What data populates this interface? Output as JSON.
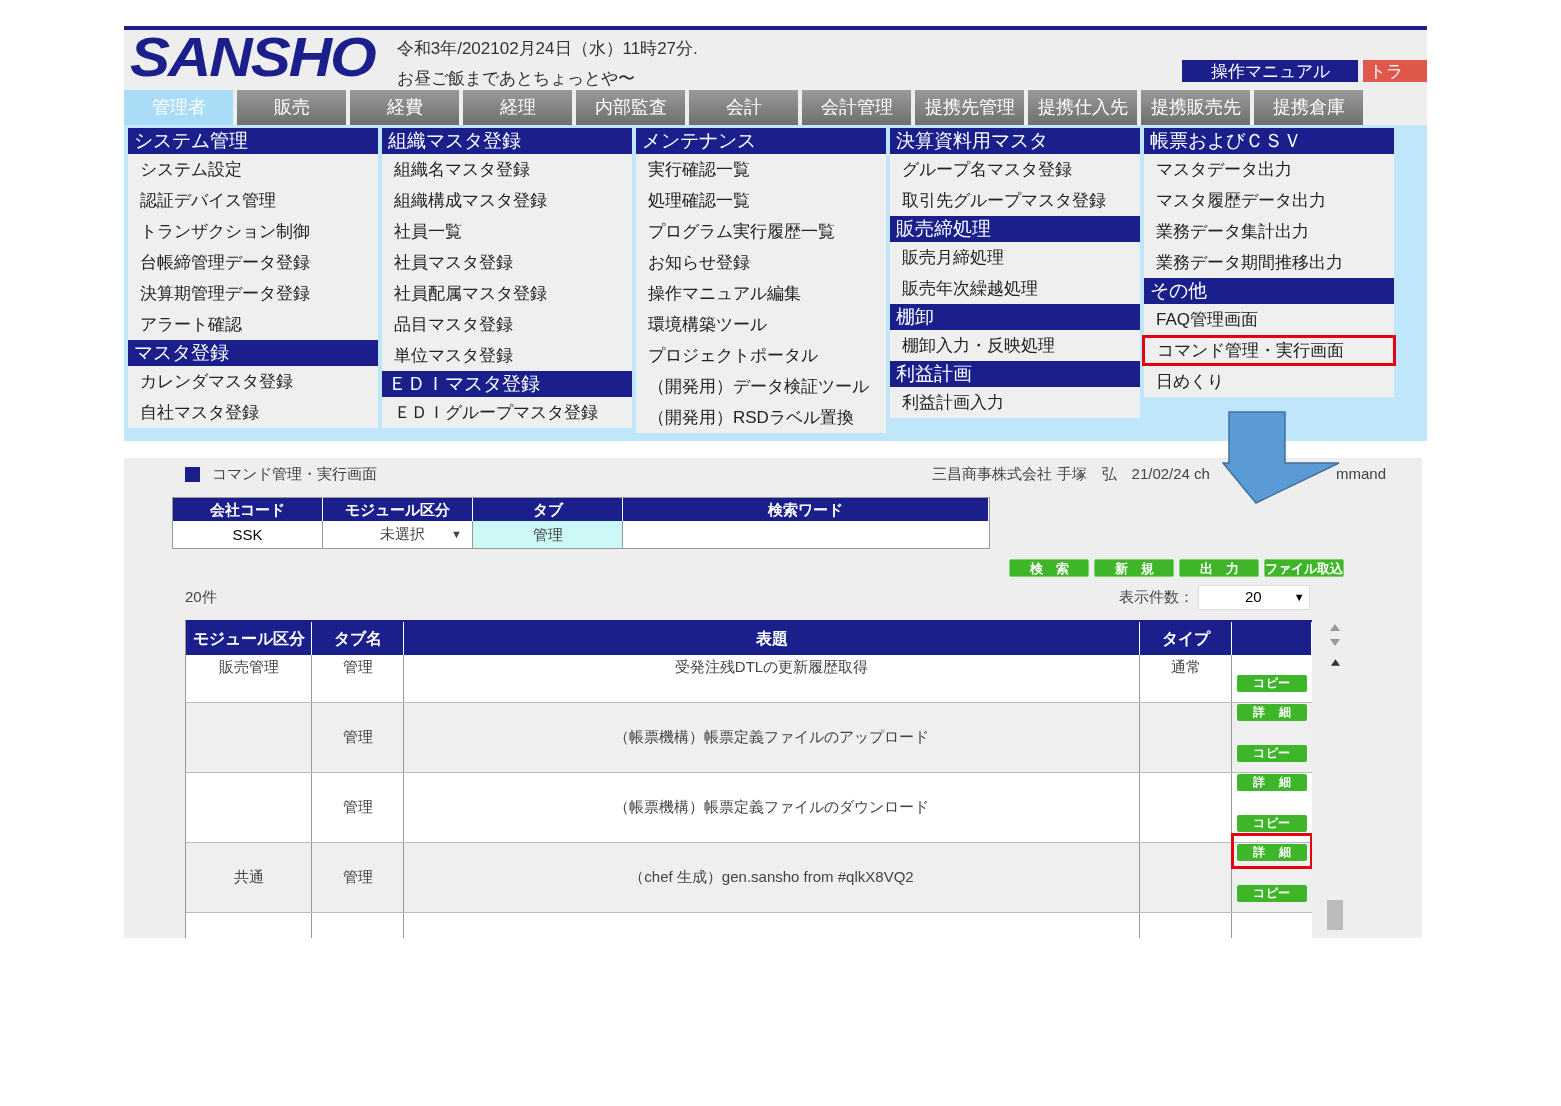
{
  "header": {
    "logo": "SANSHO",
    "datetime": "令和3年/202102月24日（水）11時27分.",
    "message": "お昼ご飯まであとちょっとや〜",
    "buttons": [
      {
        "label": "操作マニュアル",
        "color": "#1a1f8c"
      },
      {
        "label": "トラ",
        "color": "#e0574c"
      }
    ]
  },
  "nav_tabs": [
    {
      "label": "管理者",
      "selected": true
    },
    {
      "label": "販売",
      "selected": false
    },
    {
      "label": "経費",
      "selected": false
    },
    {
      "label": "経理",
      "selected": false
    },
    {
      "label": "内部監査",
      "selected": false
    },
    {
      "label": "会計",
      "selected": false
    },
    {
      "label": "会計管理",
      "selected": false
    },
    {
      "label": "提携先管理",
      "selected": false
    },
    {
      "label": "提携仕入先",
      "selected": false
    },
    {
      "label": "提携販売先",
      "selected": false
    },
    {
      "label": "提携倉庫",
      "selected": false
    }
  ],
  "menu": {
    "columns": [
      {
        "sections": [
          {
            "title": "システム管理",
            "items": [
              {
                "label": "システム設定",
                "highlighted": false
              },
              {
                "label": "認証デバイス管理",
                "highlighted": false
              },
              {
                "label": "トランザクション制御",
                "highlighted": false
              },
              {
                "label": "台帳締管理データ登録",
                "highlighted": false
              },
              {
                "label": "決算期管理データ登録",
                "highlighted": false
              },
              {
                "label": "アラート確認",
                "highlighted": false
              }
            ]
          },
          {
            "title": "マスタ登録",
            "items": [
              {
                "label": "カレンダマスタ登録",
                "highlighted": false
              },
              {
                "label": "自社マスタ登録",
                "highlighted": false
              }
            ]
          }
        ]
      },
      {
        "sections": [
          {
            "title": "組織マスタ登録",
            "items": [
              {
                "label": "組織名マスタ登録",
                "highlighted": false
              },
              {
                "label": "組織構成マスタ登録",
                "highlighted": false
              },
              {
                "label": "社員一覧",
                "highlighted": false
              },
              {
                "label": "社員マスタ登録",
                "highlighted": false
              },
              {
                "label": "社員配属マスタ登録",
                "highlighted": false
              },
              {
                "label": "品目マスタ登録",
                "highlighted": false
              },
              {
                "label": "単位マスタ登録",
                "highlighted": false
              }
            ]
          },
          {
            "title": "ＥＤＩマスタ登録",
            "items": [
              {
                "label": "ＥＤＩグループマスタ登録",
                "highlighted": false
              }
            ]
          }
        ]
      },
      {
        "sections": [
          {
            "title": "メンテナンス",
            "items": [
              {
                "label": "実行確認一覧",
                "highlighted": false
              },
              {
                "label": "処理確認一覧",
                "highlighted": false
              },
              {
                "label": "プログラム実行履歴一覧",
                "highlighted": false
              },
              {
                "label": "お知らせ登録",
                "highlighted": false
              },
              {
                "label": "操作マニュアル編集",
                "highlighted": false
              },
              {
                "label": "環境構築ツール",
                "highlighted": false
              },
              {
                "label": "プロジェクトポータル",
                "highlighted": false
              },
              {
                "label": "（開発用）データ検証ツール",
                "highlighted": false
              },
              {
                "label": "（開発用）RSDラベル置換",
                "highlighted": false
              }
            ]
          }
        ]
      },
      {
        "sections": [
          {
            "title": "決算資料用マスタ",
            "items": [
              {
                "label": "グループ名マスタ登録",
                "highlighted": false
              },
              {
                "label": "取引先グループマスタ登録",
                "highlighted": false
              }
            ]
          },
          {
            "title": "販売締処理",
            "items": [
              {
                "label": "販売月締処理",
                "highlighted": false
              },
              {
                "label": "販売年次繰越処理",
                "highlighted": false
              }
            ]
          },
          {
            "title": "棚卸",
            "items": [
              {
                "label": "棚卸入力・反映処理",
                "highlighted": false
              }
            ]
          },
          {
            "title": "利益計画",
            "items": [
              {
                "label": "利益計画入力",
                "highlighted": false
              }
            ]
          }
        ]
      },
      {
        "sections": [
          {
            "title": "帳票およびＣＳＶ",
            "items": [
              {
                "label": "マスタデータ出力",
                "highlighted": false
              },
              {
                "label": "マスタ履歴データ出力",
                "highlighted": false
              },
              {
                "label": "業務データ集計出力",
                "highlighted": false
              },
              {
                "label": "業務データ期間推移出力",
                "highlighted": false
              }
            ]
          },
          {
            "title": "その他",
            "items": [
              {
                "label": "FAQ管理画面",
                "highlighted": false
              },
              {
                "label": "コマンド管理・実行画面",
                "highlighted": true
              },
              {
                "label": "日めくり",
                "highlighted": false
              }
            ]
          }
        ]
      }
    ]
  },
  "panel": {
    "title": "コマンド管理・実行画面",
    "user_info": "三昌商事株式会社 手塚　弘　21/02/24 ch",
    "user_info_tail": "mmand",
    "search_form": {
      "columns": [
        "会社コード",
        "モジュール区分",
        "タブ",
        "検索ワード"
      ],
      "company_code": "SSK",
      "module": "未選択",
      "module_caret": "▼",
      "tab": "管理"
    },
    "actions": [
      "検　索",
      "新　規",
      "出　力",
      "ファイル取込"
    ],
    "count": "20件",
    "page_size_label": "表示件数：",
    "page_size": "20",
    "page_size_caret": "▼",
    "table": {
      "columns": [
        "モジュール区分",
        "タブ名",
        "表題",
        "タイプ"
      ],
      "rows": [
        {
          "module": "販売管理",
          "tab": "管理",
          "title": "受発注残DTLの更新履歴取得",
          "type": "通常",
          "buttons": [
            {
              "kind": "copy",
              "label": "コピー",
              "highlighted": false
            }
          ]
        },
        {
          "tab": "管理",
          "title": "（帳票機構）帳票定義ファイルのアップロード",
          "buttons": [
            {
              "kind": "detail",
              "label": "詳　細",
              "highlighted": false
            },
            {
              "kind": "copy",
              "label": "コピー",
              "highlighted": false
            }
          ]
        },
        {
          "tab": "管理",
          "title": "（帳票機構）帳票定義ファイルのダウンロード",
          "buttons": [
            {
              "kind": "detail",
              "label": "詳　細",
              "highlighted": false
            },
            {
              "kind": "copy",
              "label": "コピー",
              "highlighted": false
            }
          ]
        },
        {
          "module": "共通",
          "tab": "管理",
          "title": "（chef 生成）gen.sansho from #qlkX8VQ2",
          "buttons": [
            {
              "kind": "detail",
              "label": "詳　細",
              "highlighted": true
            },
            {
              "kind": "copy",
              "label": "コピー",
              "highlighted": false
            }
          ]
        }
      ]
    }
  }
}
